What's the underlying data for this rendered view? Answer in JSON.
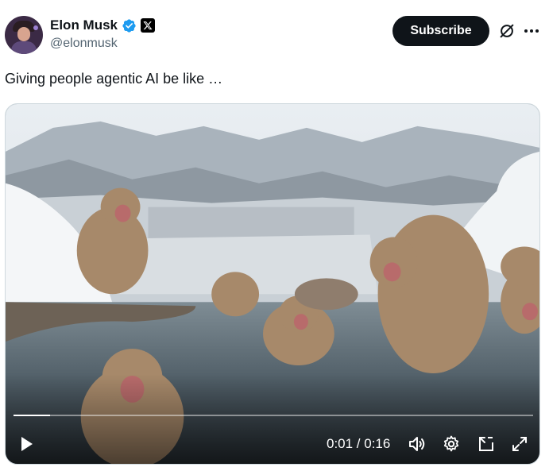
{
  "author": {
    "display_name": "Elon Musk",
    "handle": "@elonmusk",
    "verified_icon": "verified-check-icon",
    "affiliate_icon": "x-logo-icon"
  },
  "header": {
    "subscribe_label": "Subscribe",
    "grok_icon": "grok-icon",
    "more_icon": "more-dots-icon"
  },
  "post": {
    "text": "Giving people agentic AI be like …"
  },
  "video": {
    "current_time": "0:01",
    "separator": " / ",
    "duration": "0:16",
    "time_display": "0:01 / 0:16",
    "progress_fraction": 0.07,
    "controls": [
      "play-icon",
      "volume-icon",
      "settings-icon",
      "pip-icon",
      "fullscreen-icon"
    ]
  },
  "colors": {
    "verified_blue": "#1d9bf0",
    "text_primary": "#0f1419",
    "text_secondary": "#536471",
    "subscribe_bg": "#0f1419"
  }
}
